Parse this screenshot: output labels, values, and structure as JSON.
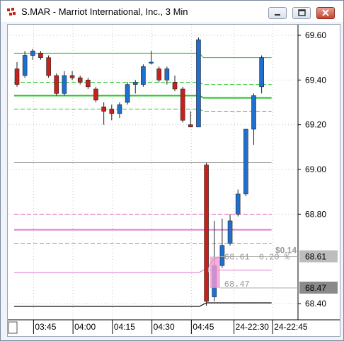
{
  "window": {
    "title": "S.MAR - Marriot International, Inc., 3 Min",
    "buttons": [
      "minimize",
      "restore",
      "close"
    ],
    "icon": "app-icon"
  },
  "chart_data": {
    "type": "candlestick",
    "symbol": "S.MAR",
    "interval": "3 Min",
    "y_ticks": [
      "69.60",
      "69.40",
      "69.20",
      "69.00",
      "68.80",
      "68.40"
    ],
    "ylim": [
      68.37,
      69.65
    ],
    "x_ticks": [
      "03:45",
      "04:00",
      "04:15",
      "04:30",
      "04:45",
      "24-22:30",
      "24-22:45"
    ],
    "colors": {
      "up": "#1f6fd0",
      "down": "#c8201a",
      "ma_green": "#22c322",
      "ma_pink": "#e070d0",
      "gray": "#888888"
    },
    "candles": [
      {
        "o": 69.45,
        "h": 69.48,
        "l": 69.37,
        "c": 69.38
      },
      {
        "o": 69.42,
        "h": 69.53,
        "l": 69.41,
        "c": 69.51
      },
      {
        "o": 69.51,
        "h": 69.54,
        "l": 69.49,
        "c": 69.53
      },
      {
        "o": 69.52,
        "h": 69.53,
        "l": 69.49,
        "c": 69.5
      },
      {
        "o": 69.5,
        "h": 69.51,
        "l": 69.41,
        "c": 69.42
      },
      {
        "o": 69.42,
        "h": 69.43,
        "l": 69.33,
        "c": 69.34
      },
      {
        "o": 69.34,
        "h": 69.44,
        "l": 69.33,
        "c": 69.42
      },
      {
        "o": 69.42,
        "h": 69.44,
        "l": 69.4,
        "c": 69.41
      },
      {
        "o": 69.41,
        "h": 69.42,
        "l": 69.38,
        "c": 69.39
      },
      {
        "o": 69.4,
        "h": 69.41,
        "l": 69.36,
        "c": 69.37
      },
      {
        "o": 69.36,
        "h": 69.37,
        "l": 69.3,
        "c": 69.31
      },
      {
        "o": 69.28,
        "h": 69.3,
        "l": 69.2,
        "c": 69.26
      },
      {
        "o": 69.27,
        "h": 69.29,
        "l": 69.22,
        "c": 69.25
      },
      {
        "o": 69.25,
        "h": 69.3,
        "l": 69.23,
        "c": 69.29
      },
      {
        "o": 69.3,
        "h": 69.39,
        "l": 69.29,
        "c": 69.38
      },
      {
        "o": 69.38,
        "h": 69.4,
        "l": 69.34,
        "c": 69.39
      },
      {
        "o": 69.38,
        "h": 69.47,
        "l": 69.37,
        "c": 69.46
      },
      {
        "o": 69.48,
        "h": 69.53,
        "l": 69.47,
        "c": 69.48
      },
      {
        "o": 69.45,
        "h": 69.46,
        "l": 69.39,
        "c": 69.4
      },
      {
        "o": 69.4,
        "h": 69.46,
        "l": 69.38,
        "c": 69.45
      },
      {
        "o": 69.39,
        "h": 69.42,
        "l": 69.35,
        "c": 69.36
      },
      {
        "o": 69.36,
        "h": 69.37,
        "l": 69.21,
        "c": 69.22
      },
      {
        "o": 69.2,
        "h": 69.26,
        "l": 69.19,
        "c": 69.19
      },
      {
        "o": 69.19,
        "h": 69.59,
        "l": 69.19,
        "c": 69.58
      },
      {
        "o": 69.02,
        "h": 69.03,
        "l": 68.39,
        "c": 68.41
      },
      {
        "o": 68.43,
        "h": 68.77,
        "l": 68.41,
        "c": 68.57
      },
      {
        "o": 68.57,
        "h": 68.78,
        "l": 68.56,
        "c": 68.66
      },
      {
        "o": 68.67,
        "h": 68.8,
        "l": 68.66,
        "c": 68.77
      },
      {
        "o": 68.8,
        "h": 68.91,
        "l": 68.79,
        "c": 68.89
      },
      {
        "o": 68.89,
        "h": 69.02,
        "l": 68.88,
        "c": 69.18
      },
      {
        "o": 69.18,
        "h": 69.34,
        "l": 69.11,
        "c": 69.33
      },
      {
        "o": 69.37,
        "h": 69.51,
        "l": 69.34,
        "c": 69.5
      }
    ],
    "lines": [
      {
        "kind": "ma_green",
        "style": "solid",
        "width": 1,
        "from": 69.52,
        "to": 69.5
      },
      {
        "kind": "ma_green",
        "style": "dashed",
        "width": 1,
        "from": 69.39,
        "to": 69.38
      },
      {
        "kind": "ma_green",
        "style": "solid",
        "width": 2,
        "from": 69.33,
        "to": 69.32
      },
      {
        "kind": "ma_green",
        "style": "dashed",
        "width": 1,
        "from": 69.27,
        "to": 69.26
      },
      {
        "kind": "gray",
        "style": "solid",
        "width": 1,
        "from": 69.03,
        "to": 69.03
      },
      {
        "kind": "ma_pink",
        "style": "dashed",
        "width": 1,
        "from": 68.8,
        "to": 68.8
      },
      {
        "kind": "ma_pink",
        "style": "solid",
        "width": 2,
        "from": 68.73,
        "to": 68.73
      },
      {
        "kind": "ma_pink",
        "style": "dashed",
        "width": 1,
        "from": 68.67,
        "to": 68.67
      },
      {
        "kind": "ma_pink",
        "style": "solid",
        "width": 1,
        "from": 68.54,
        "to": 68.55
      }
    ],
    "price_markers": [
      {
        "label": "68.61",
        "value": 68.61,
        "style": "light"
      },
      {
        "label": "68.47",
        "value": 68.47,
        "style": "dark"
      }
    ],
    "annotations": {
      "change": "$0.14",
      "high": "68.61",
      "pct": "0.20 %",
      "low": "68.47"
    }
  }
}
